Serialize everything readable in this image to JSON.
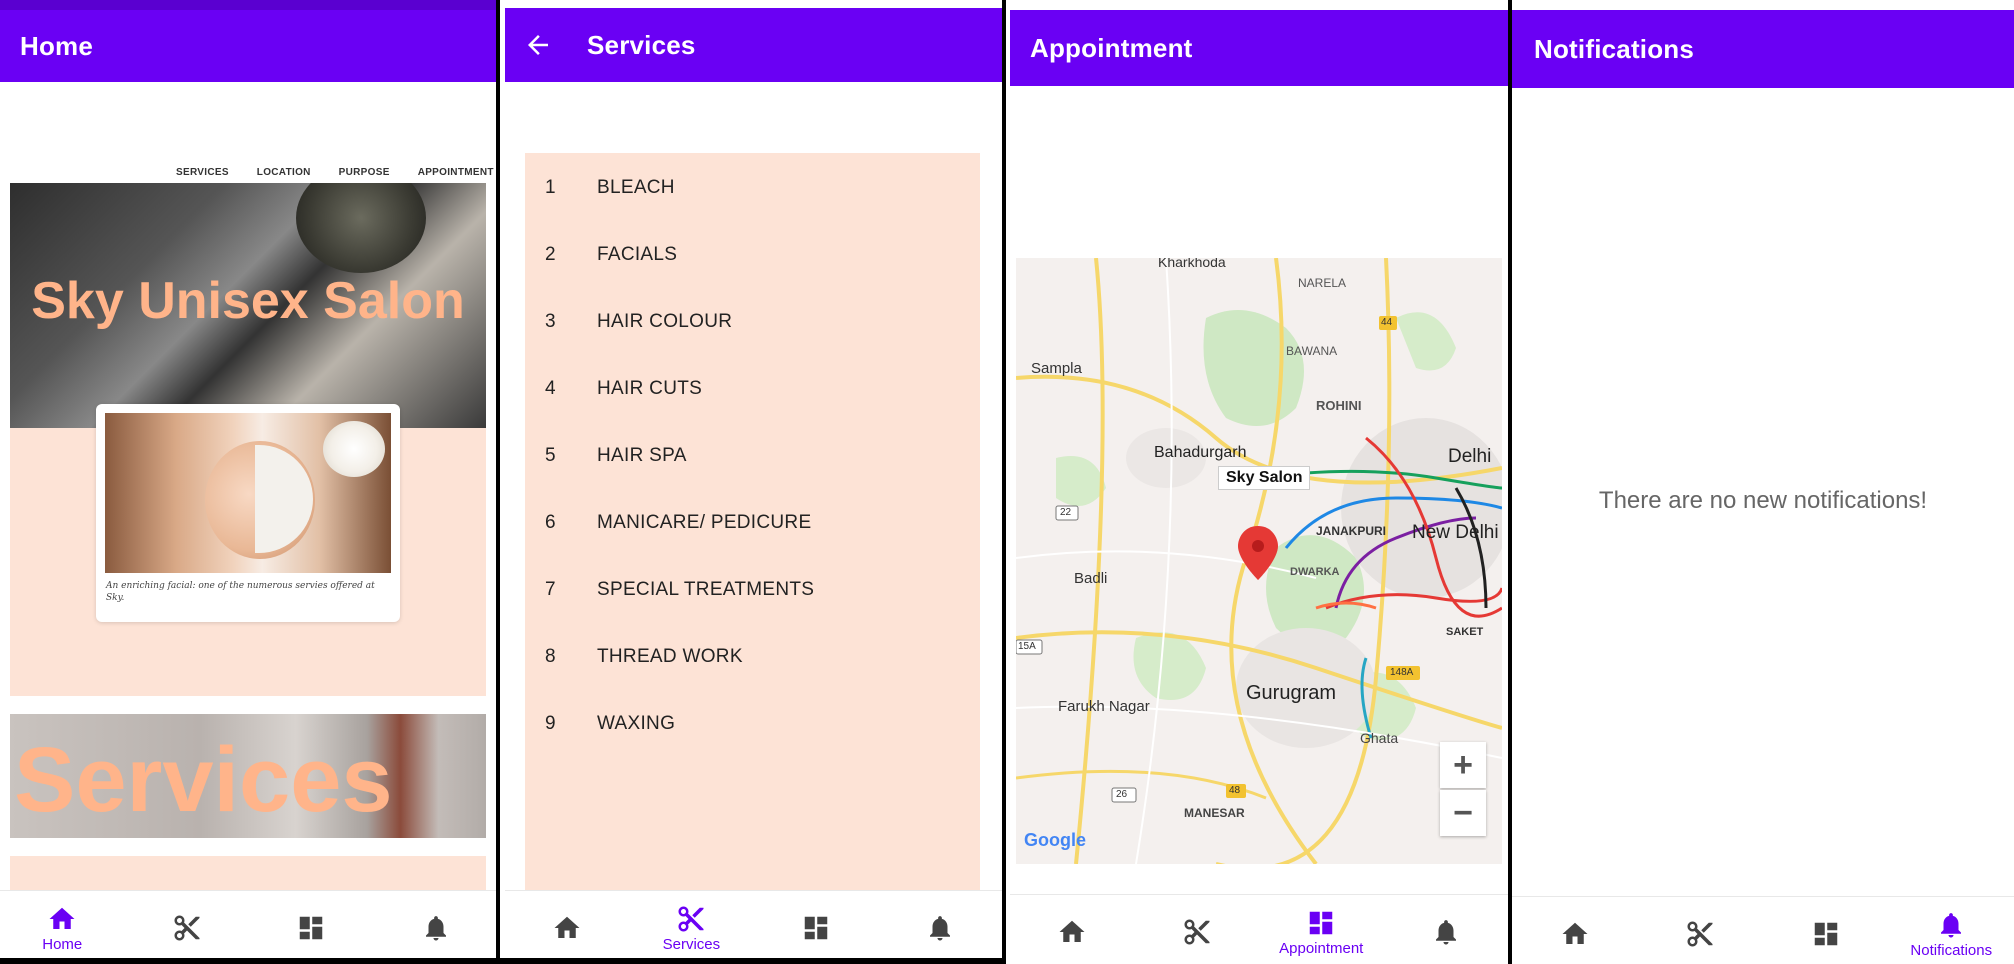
{
  "nav": {
    "home": "Home",
    "services": "Services",
    "appointment": "Appointment",
    "notifications": "Notifications"
  },
  "home": {
    "title": "Home",
    "links": [
      "SERVICES",
      "LOCATION",
      "PURPOSE",
      "APPOINTMENT"
    ],
    "hero_title": "Sky Unisex Salon",
    "card_caption": "An enriching facial: one of the numerous servies offered at Sky.",
    "banner_text": "Services"
  },
  "services": {
    "title": "Services",
    "items": [
      {
        "num": "1",
        "name": "BLEACH"
      },
      {
        "num": "2",
        "name": "FACIALS"
      },
      {
        "num": "3",
        "name": "HAIR COLOUR"
      },
      {
        "num": "4",
        "name": "HAIR CUTS"
      },
      {
        "num": "5",
        "name": "HAIR SPA"
      },
      {
        "num": "6",
        "name": "MANICARE/ PEDICURE"
      },
      {
        "num": "7",
        "name": "SPECIAL TREATMENTS"
      },
      {
        "num": "8",
        "name": "THREAD WORK"
      },
      {
        "num": "9",
        "name": "WAXING"
      }
    ]
  },
  "appointment": {
    "title": "Appointment",
    "marker_label": "Sky Salon",
    "map_labels": {
      "kharkhoda": "Kharkhoda",
      "narela": "NARELA",
      "bawana": "BAWANA",
      "sampla": "Sampla",
      "rohini": "ROHINI",
      "bahadurgarh": "Bahadurgarh",
      "delhi": "Delhi",
      "janakpuri": "JANAKPURI",
      "new_delhi": "New Delhi",
      "dwarka": "DWARKA",
      "badli": "Badli",
      "saket": "SAKET",
      "farukh_nagar": "Farukh Nagar",
      "gurugram": "Gurugram",
      "ghata": "Ghata",
      "manesar": "MANESAR",
      "google": "Google",
      "r44": "44",
      "r22": "22",
      "r15a": "15A",
      "r148a": "148A",
      "r26": "26",
      "r48": "48"
    },
    "zoom_in": "+",
    "zoom_out": "−"
  },
  "notifications": {
    "title": "Notifications",
    "empty_message": "There are no new notifications!"
  },
  "colors": {
    "primary": "#6a00f4",
    "peach": "#fde3d6",
    "hero_text": "#ffb48a"
  }
}
